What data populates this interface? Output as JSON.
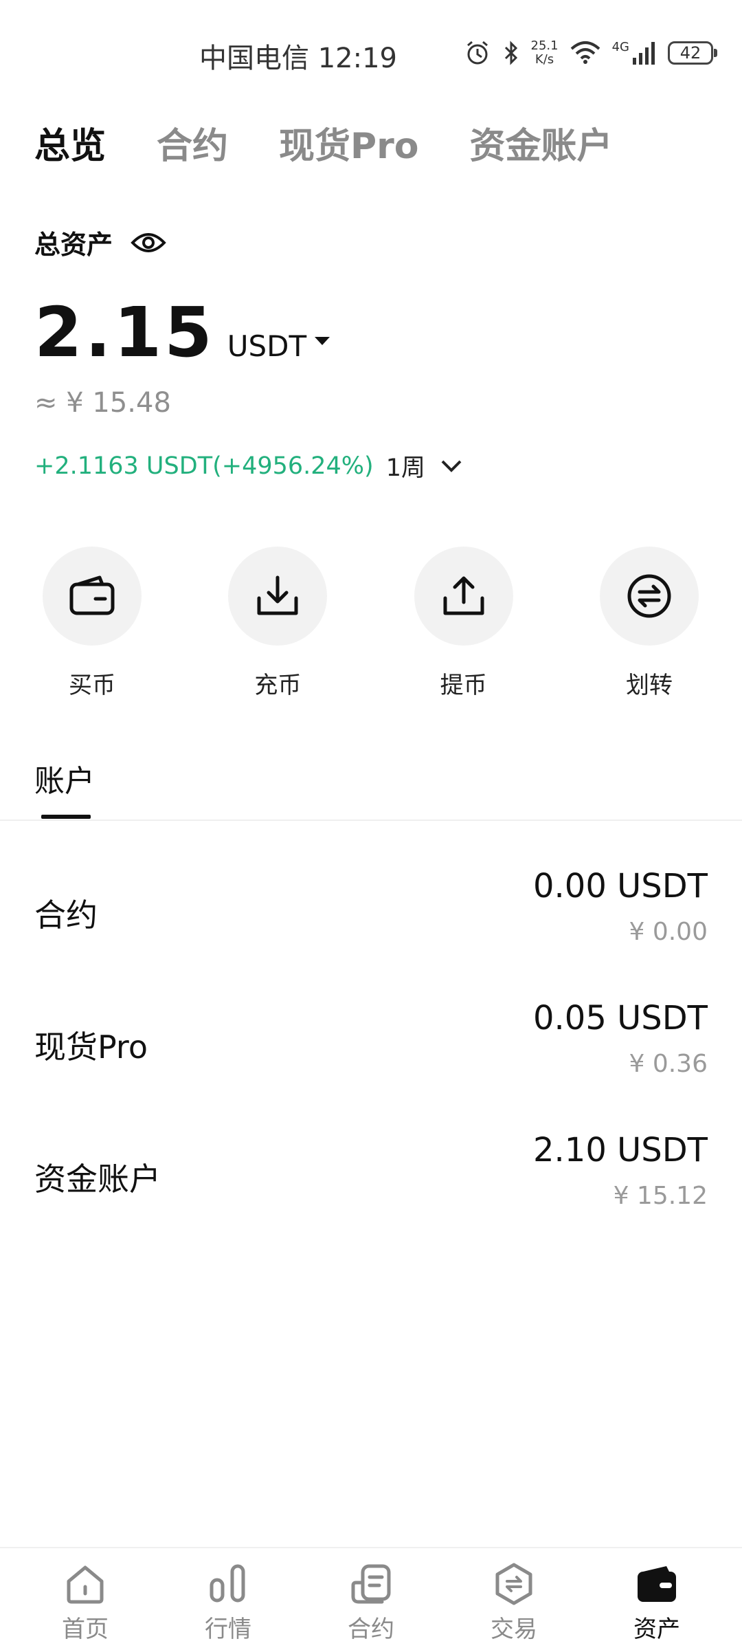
{
  "status_bar": {
    "carrier_time": "中国电信 12:19",
    "net_speed_value": "25.1",
    "net_speed_unit": "K/s",
    "network": "4G",
    "battery": "42"
  },
  "top_tabs": [
    {
      "label": "总览",
      "active": true
    },
    {
      "label": "合约",
      "active": false
    },
    {
      "label": "现货Pro",
      "active": false
    },
    {
      "label": "资金账户",
      "active": false
    }
  ],
  "overview": {
    "total_label": "总资产",
    "balance": "2.15",
    "unit": "USDT",
    "approx": "≈ ¥ 15.48",
    "pnl": "+2.1163 USDT(+4956.24%)",
    "period": "1周"
  },
  "actions": [
    {
      "label": "买币",
      "icon": "wallet-icon"
    },
    {
      "label": "充币",
      "icon": "deposit-icon"
    },
    {
      "label": "提币",
      "icon": "withdraw-icon"
    },
    {
      "label": "划转",
      "icon": "transfer-icon"
    }
  ],
  "account_section": {
    "tab_label": "账户"
  },
  "accounts": [
    {
      "name": "合约",
      "amount": "0.00 USDT",
      "cny": "¥ 0.00"
    },
    {
      "name": "现货Pro",
      "amount": "0.05 USDT",
      "cny": "¥ 0.36"
    },
    {
      "name": "资金账户",
      "amount": "2.10 USDT",
      "cny": "¥ 15.12"
    }
  ],
  "bottom_nav": [
    {
      "label": "首页",
      "icon": "home-icon",
      "active": false
    },
    {
      "label": "行情",
      "icon": "market-icon",
      "active": false
    },
    {
      "label": "合约",
      "icon": "contract-icon",
      "active": false
    },
    {
      "label": "交易",
      "icon": "trade-icon",
      "active": false
    },
    {
      "label": "资产",
      "icon": "assets-wallet-icon",
      "active": true
    }
  ],
  "colors": {
    "profit_green": "#22b07d",
    "text_primary": "#111111",
    "text_secondary": "#8a8a8a",
    "action_bg": "#f2f2f2"
  }
}
